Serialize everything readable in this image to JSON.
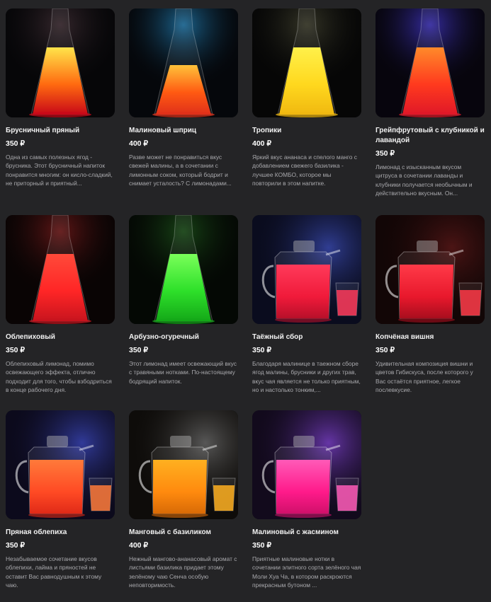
{
  "products": [
    {
      "name": "Брусничный пряный",
      "price": "350 ₽",
      "desc": "Одна из самых полезных ягод - брусника. Этот брусничный напиток понравится многим: он кисло-сладкий, не приторный и приятный...",
      "kind": "carafe",
      "colors": [
        "#ffe44a",
        "#ff6a10",
        "#c80818"
      ],
      "bg": "#060608",
      "glow": "#3a2a30"
    },
    {
      "name": "Малиновый шприц",
      "price": "400 ₽",
      "desc": "Разве может не понравиться вкус свежей малины, а в сочетании с лимонным соком, который бодрит и снимает усталость? С лимонадами...",
      "kind": "carafe",
      "colors": [
        "#ffc23a",
        "#ff5a12",
        "#e0301a"
      ],
      "bg": "#05070b",
      "glow": "#1e6f9e"
    },
    {
      "name": "Тропики",
      "price": "400 ₽",
      "desc": "Яркий вкус ананаса и спелого манго с добавлением свежего базилика - лучшее КОМБО, которое мы повторили в этом напитке.",
      "kind": "carafe",
      "colors": [
        "#fff04a",
        "#ffd81e",
        "#f0b810"
      ],
      "bg": "#060606",
      "glow": "#3a3a2a"
    },
    {
      "name": "Грейпфрутовый с клубникой и лавандой",
      "price": "350 ₽",
      "desc": "Лимонад с изысканным вкусом цитруса в сочетании лаванды и клубники получается необычным и действительно вкусным. Он...",
      "kind": "carafe",
      "colors": [
        "#ff8a2a",
        "#ff3a1e",
        "#e01828"
      ],
      "bg": "#07050d",
      "glow": "#3a30b0"
    },
    {
      "name": "Облепиховый",
      "price": "350 ₽",
      "desc": "Облепиховый лимонад, помимо освежающего эффекта, отлично подходит для того, чтобы взбодриться в конце рабочего дня.",
      "kind": "carafe",
      "colors": [
        "#ff4a3a",
        "#ff2626",
        "#c8141e"
      ],
      "bg": "#090404",
      "glow": "#6a1818"
    },
    {
      "name": "Арбузно-огуречный",
      "price": "350 ₽",
      "desc": "Этот лимонад имеет освежающий вкус с травяными нотками. По-настоящему бодрящий напиток.",
      "kind": "carafe",
      "colors": [
        "#7aff5a",
        "#2ee02a",
        "#14a818"
      ],
      "bg": "#040804",
      "glow": "#1a4a18"
    },
    {
      "name": "Таёжный сбор",
      "price": "350 ₽",
      "desc": "Благодаря малинице в таежном сборе ягод малины, брусники и других трав, вкус чая является не только приятным, но и настолько тонким,...",
      "kind": "teapot",
      "colors": [
        "#ff3a5a",
        "#f01a3a",
        "#b8102a"
      ],
      "bg": "#0a0c1e",
      "glow": "#3a4ab0"
    },
    {
      "name": "Копчёная вишня",
      "price": "350 ₽",
      "desc": "Удивительная композиция вишни и цветов Гибискуса, после которого у Вас остаётся приятное, легкое послевкусие.",
      "kind": "teapot",
      "colors": [
        "#ff3a48",
        "#e8182c",
        "#a80e1e"
      ],
      "bg": "#120606",
      "glow": "#5a1818"
    },
    {
      "name": "Пряная облепиха",
      "price": "350 ₽",
      "desc": "Незабываемое сочетание вкусов облепихи, лайма и пряностей не оставит Вас равнодушным к этому чаю.",
      "kind": "teapot",
      "colors": [
        "#ff7a3a",
        "#ff4a24",
        "#e02a18"
      ],
      "bg": "#0c0a1c",
      "glow": "#3a46b8"
    },
    {
      "name": "Манговый с базиликом",
      "price": "400 ₽",
      "desc": "Нежный мангово-ананасовый аромат с листьями базилика придает этому зелёному чаю Сенча особую неповторимость.",
      "kind": "teapot",
      "colors": [
        "#ffb020",
        "#ff8a0e",
        "#d86a06"
      ],
      "bg": "#0e0c0a",
      "glow": "#6a6a6a"
    },
    {
      "name": "Малиновый с жасмином",
      "price": "350 ₽",
      "desc": "Приятные малиновые нотки в сочетании  элитного сорта зелёного чая Моли Хуа Ча, в котором раскроются прекрасным бутоном ...",
      "kind": "teapot",
      "colors": [
        "#ff5ab8",
        "#ff1a8a",
        "#d0106a"
      ],
      "bg": "#120a1c",
      "glow": "#7a40c8"
    }
  ]
}
